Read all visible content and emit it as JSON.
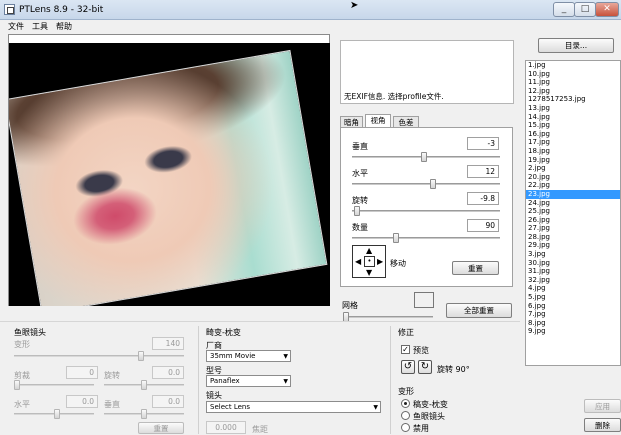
{
  "window": {
    "title": "PTLens 8.9 - 32-bit",
    "controls": [
      "minimize-icon",
      "maximize-icon",
      "close-icon"
    ]
  },
  "menu": [
    "文件",
    "工具",
    "帮助"
  ],
  "exif_message": "无EXIF信息. 选择profile文件.",
  "tabs": [
    "暗角",
    "视角",
    "色差"
  ],
  "active_tab": "视角",
  "perspective": {
    "vertical": {
      "label": "垂直",
      "value": "-3",
      "level": 0.5
    },
    "horizontal": {
      "label": "水平",
      "value": "12",
      "level": 0.56
    },
    "rotate": {
      "label": "旋转",
      "value": "-9.8",
      "level": 0.02
    },
    "scale": {
      "label": "数量",
      "value": "90",
      "level": 0.27
    },
    "move_label": "移动",
    "reset_label": "重置"
  },
  "grid": {
    "label": "网格",
    "level": 0.0
  },
  "reset_all_label": "全部重置",
  "directory_button": "目录...",
  "files": [
    "1.jpg",
    "10.jpg",
    "11.jpg",
    "12.jpg",
    "1278517253.jpg",
    "13.jpg",
    "14.jpg",
    "15.jpg",
    "16.jpg",
    "17.jpg",
    "18.jpg",
    "19.jpg",
    "2.jpg",
    "20.jpg",
    "22.jpg",
    "23.jpg",
    "24.jpg",
    "25.jpg",
    "26.jpg",
    "27.jpg",
    "28.jpg",
    "29.jpg",
    "3.jpg",
    "30.jpg",
    "31.jpg",
    "32.jpg",
    "4.jpg",
    "5.jpg",
    "6.jpg",
    "7.jpg",
    "8.jpg",
    "9.jpg"
  ],
  "selected_file": "23.jpg",
  "fisheye": {
    "title": "鱼眼镜头",
    "distortion": {
      "label": "变形",
      "value": "140"
    },
    "crop": {
      "label": "剪裁",
      "value": "0"
    },
    "rotate": {
      "label": "旋转",
      "value": "0.0"
    },
    "horizontal": {
      "label": "水平",
      "value": "0.0"
    },
    "vertical": {
      "label": "垂直",
      "value": "0.0"
    },
    "reset_label": "重置"
  },
  "lens": {
    "title": "畸变-枕变",
    "manufacturer_label": "厂商",
    "manufacturer_value": "35mm Movie",
    "model_label": "型号",
    "model_value": "Panaflex",
    "lens_label": "镜头",
    "lens_value": "Select Lens",
    "focal_value": "0.000",
    "focal_label": "焦距"
  },
  "correction": {
    "title": "修正",
    "preview_label": "预览",
    "preview_checked": true,
    "rotate90_label": "旋转 90°",
    "distortion_title": "变形",
    "options": [
      "稿变-枕变",
      "鱼眼镜头",
      "禁用"
    ],
    "selected_option": 0
  },
  "apply_label": "应用",
  "delete_label": "删除"
}
